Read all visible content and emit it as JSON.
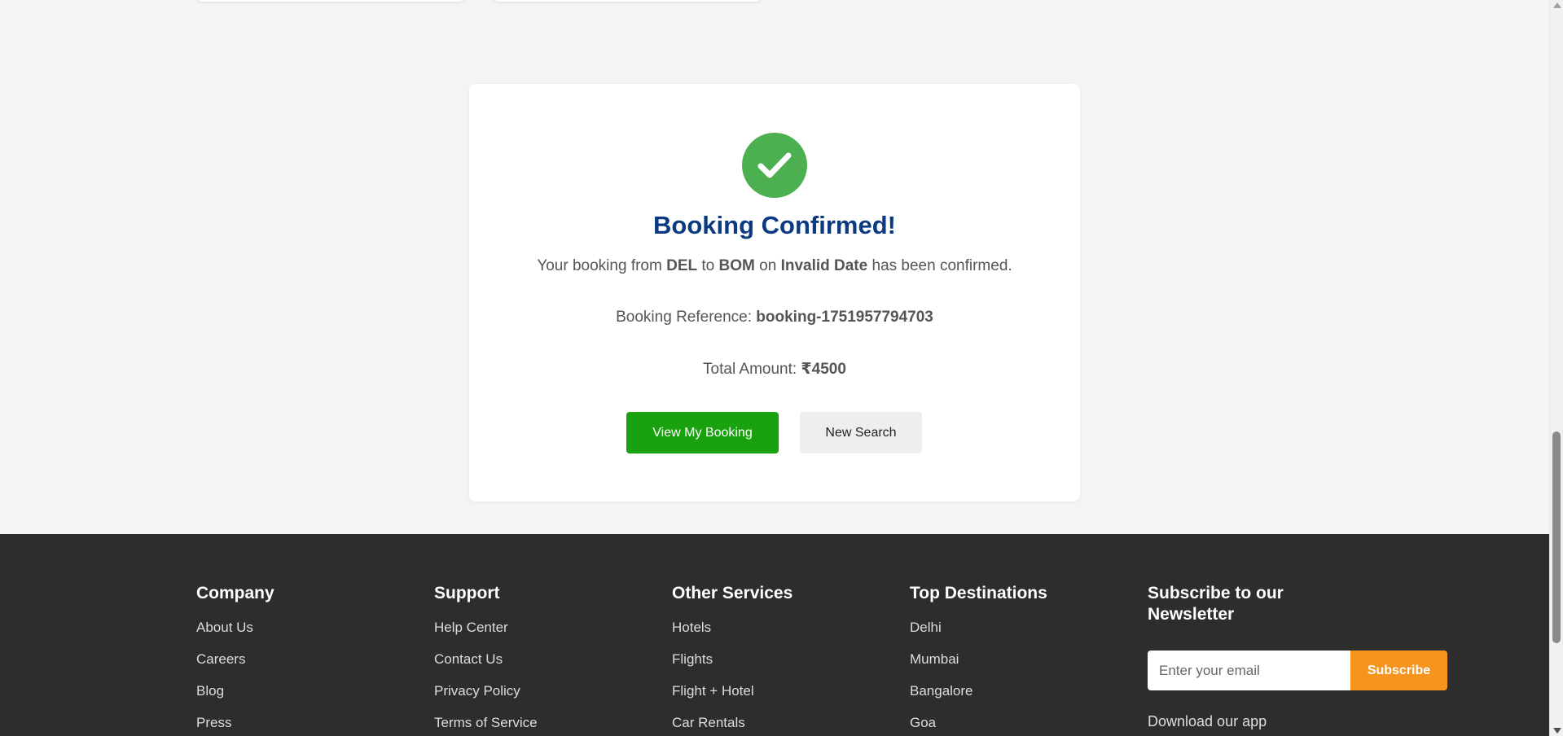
{
  "confirmation": {
    "icon": "check-circle-icon",
    "title": "Booking Confirmed!",
    "route": {
      "prefix": "Your booking from",
      "from": "DEL",
      "to_word": "to",
      "to": "BOM",
      "on_word": "on",
      "date": "Invalid Date",
      "suffix": "has been confirmed."
    },
    "reference": {
      "label": "Booking Reference:",
      "value": "booking-1751957794703"
    },
    "total": {
      "label": "Total Amount:",
      "value": "₹4500"
    },
    "buttons": {
      "view_booking": "View My Booking",
      "new_search": "New Search"
    },
    "colors": {
      "success": "#4caf50",
      "title": "#0b3a82",
      "primary_button": "#1aa10f"
    }
  },
  "footer": {
    "columns": [
      {
        "heading": "Company",
        "links": [
          "About Us",
          "Careers",
          "Blog",
          "Press"
        ]
      },
      {
        "heading": "Support",
        "links": [
          "Help Center",
          "Contact Us",
          "Privacy Policy",
          "Terms of Service"
        ]
      },
      {
        "heading": "Other Services",
        "links": [
          "Hotels",
          "Flights",
          "Flight + Hotel",
          "Car Rentals"
        ]
      },
      {
        "heading": "Top Destinations",
        "links": [
          "Delhi",
          "Mumbai",
          "Bangalore",
          "Goa"
        ]
      }
    ],
    "newsletter": {
      "heading": "Subscribe to our Newsletter",
      "placeholder": "Enter your email",
      "button": "Subscribe",
      "download_text": "Download our app"
    },
    "colors": {
      "background": "#2d2d2d",
      "subscribe_button": "#f7941d"
    }
  }
}
